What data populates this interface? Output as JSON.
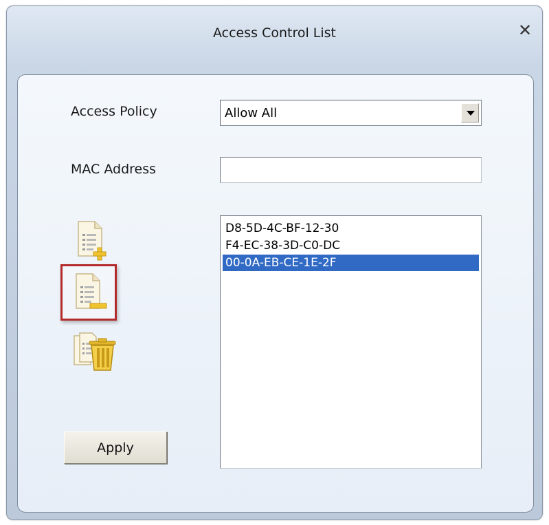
{
  "window": {
    "title": "Access Control List",
    "close_glyph": "✕"
  },
  "form": {
    "access_policy_label": "Access Policy",
    "access_policy_value": "Allow All",
    "mac_address_label": "MAC Address",
    "mac_address_value": ""
  },
  "mac_list": {
    "items": [
      "D8-5D-4C-BF-12-30",
      "F4-EC-38-3D-C0-DC",
      "00-0A-EB-CE-1E-2F"
    ],
    "selected_index": 2,
    "selection_color": "#316ac5"
  },
  "icons": {
    "add": "add-entry-icon",
    "delete": "delete-entry-icon",
    "delete_all": "delete-all-icon",
    "highlight_color": "#b32a2a"
  },
  "buttons": {
    "apply_label": "Apply"
  }
}
